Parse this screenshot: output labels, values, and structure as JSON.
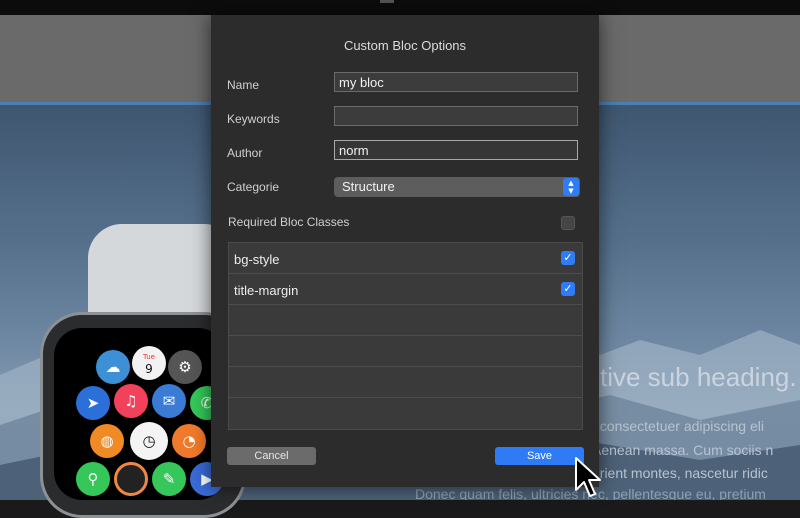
{
  "dialog": {
    "title": "Custom Bloc Options",
    "fields": {
      "name_label": "Name",
      "name_value": "my bloc",
      "keywords_label": "Keywords",
      "keywords_value": "",
      "author_label": "Author",
      "author_value": "norm",
      "category_label": "Categorie",
      "category_value": "Structure"
    },
    "required_label": "Required Bloc Classes",
    "classes": [
      {
        "name": "bg-style",
        "checked": true
      },
      {
        "name": "title-margin",
        "checked": true
      }
    ],
    "buttons": {
      "cancel": "Cancel",
      "save": "Save"
    }
  },
  "background": {
    "hero_heading": "tive sub heading.",
    "hero_lines": [
      ", consectetuer adipiscing eli",
      "Aenean massa. Cum sociis n",
      "urient montes, nascetur ridic",
      "Donec quam felis, ultricies nec, pellentesque eu, pretium"
    ],
    "watch_calendar": {
      "day": "Tue",
      "date": "9"
    }
  },
  "colors": {
    "accent": "#2f7bf5",
    "dialog_bg": "#2c2c2c",
    "header_line": "#4a7fb5"
  },
  "icons": {
    "select_stepper": "chevron-up-down-icon",
    "checkbox": "checkmark-icon",
    "cursor": "mouse-pointer-icon"
  }
}
